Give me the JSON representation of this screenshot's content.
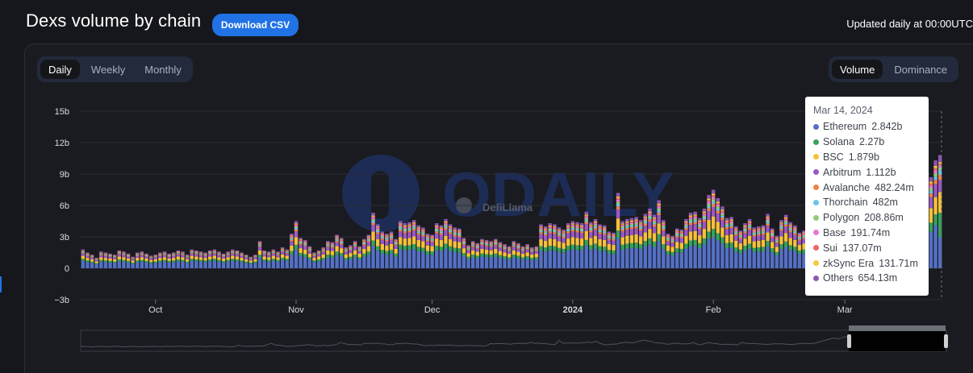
{
  "header": {
    "title": "Dexs volume by chain",
    "download_label": "Download CSV",
    "updated_text": "Updated daily at 00:00UTC"
  },
  "controls": {
    "interval_tabs": [
      "Daily",
      "Weekly",
      "Monthly"
    ],
    "interval_active": "Daily",
    "mode_tabs": [
      "Volume",
      "Dominance"
    ],
    "mode_active": "Volume"
  },
  "watermark": {
    "logo_text": "ODAILY",
    "sub_text": "DefiLlama"
  },
  "tooltip": {
    "date": "Mar 14, 2024",
    "items": [
      {
        "name": "Ethereum",
        "value": "2.842b",
        "color": "#5470c6"
      },
      {
        "name": "Solana",
        "value": "2.27b",
        "color": "#38a15c"
      },
      {
        "name": "BSC",
        "value": "1.879b",
        "color": "#f5c13b"
      },
      {
        "name": "Arbitrum",
        "value": "1.112b",
        "color": "#9c58c5"
      },
      {
        "name": "Avalanche",
        "value": "482.24m",
        "color": "#f0804a"
      },
      {
        "name": "Thorchain",
        "value": "482m",
        "color": "#6cc3e8"
      },
      {
        "name": "Polygon",
        "value": "208.86m",
        "color": "#91cc75"
      },
      {
        "name": "Base",
        "value": "191.74m",
        "color": "#e67ad0"
      },
      {
        "name": "Sui",
        "value": "137.07m",
        "color": "#ee6666"
      },
      {
        "name": "zkSync Era",
        "value": "131.71m",
        "color": "#f7c83f"
      },
      {
        "name": "Others",
        "value": "654.13m",
        "color": "#8e56b2"
      }
    ]
  },
  "chart_data": {
    "type": "bar",
    "stacked": true,
    "ylim": [
      -3,
      15
    ],
    "y_ticks": [
      "15b",
      "12b",
      "9b",
      "6b",
      "3b",
      "0",
      "−3b"
    ],
    "x_ticks": [
      "Oct",
      "Nov",
      "Dec",
      "2024",
      "Feb",
      "Mar"
    ],
    "grid": true,
    "date_range": [
      "2023-09-15",
      "2024-03-14"
    ],
    "stack_order": [
      "Ethereum",
      "Solana",
      "BSC",
      "Arbitrum",
      "Avalanche",
      "Thorchain",
      "Polygon",
      "Base",
      "Sui",
      "zkSync Era",
      "Others"
    ],
    "total_volume_b": [
      1.8,
      1.5,
      1.3,
      1.0,
      1.6,
      1.5,
      1.4,
      1.3,
      1.7,
      1.6,
      1.4,
      1.1,
      1.5,
      1.6,
      1.4,
      1.2,
      1.3,
      1.5,
      1.6,
      1.4,
      1.5,
      1.7,
      1.6,
      1.3,
      1.8,
      1.7,
      1.6,
      1.5,
      1.7,
      1.8,
      1.6,
      1.4,
      1.6,
      1.8,
      1.7,
      1.5,
      1.3,
      1.1,
      1.3,
      2.6,
      1.7,
      1.6,
      1.8,
      1.6,
      2.0,
      1.8,
      3.3,
      4.5,
      2.9,
      2.7,
      2.1,
      1.5,
      1.7,
      2.0,
      2.6,
      2.5,
      3.2,
      2.9,
      2.0,
      2.2,
      2.6,
      2.1,
      2.8,
      3.2,
      5.3,
      4.2,
      3.5,
      3.3,
      3.5,
      2.8,
      4.5,
      4.3,
      4.4,
      4.6,
      4.1,
      3.9,
      3.3,
      3.2,
      4.3,
      4.1,
      4.7,
      4.2,
      3.9,
      3.8,
      2.9,
      2.2,
      2.6,
      2.4,
      2.8,
      2.7,
      2.6,
      2.8,
      2.5,
      2.3,
      2.1,
      2.6,
      2.4,
      2.1,
      2.3,
      2.0,
      2.1,
      4.2,
      4.0,
      4.3,
      4.2,
      3.9,
      3.7,
      4.3,
      4.5,
      4.4,
      4.3,
      5.4,
      4.4,
      4.7,
      4.2,
      4.1,
      3.5,
      3.4,
      7.2,
      4.5,
      4.7,
      4.8,
      4.9,
      4.6,
      5.2,
      5.7,
      5.1,
      6.5,
      4.6,
      3.3,
      3.1,
      3.8,
      3.7,
      4.7,
      5.3,
      5.4,
      4.8,
      5.7,
      7.0,
      7.5,
      6.7,
      5.9,
      4.8,
      4.9,
      4.0,
      3.6,
      4.3,
      4.7,
      3.9,
      4.0,
      4.1,
      5.2,
      3.8,
      3.1,
      4.6,
      5.1,
      4.4,
      4.1,
      3.4,
      3.6,
      3.5,
      3.3,
      3.0,
      5.3,
      4.5,
      4.2,
      4.4,
      4.1,
      3.8,
      3.5,
      3.7,
      4.0,
      4.0,
      4.1,
      3.7,
      3.4,
      3.6,
      4.1,
      4.5,
      4.3,
      4.2,
      4.6,
      5.8,
      6.7,
      7.8,
      8.9,
      9.5,
      8.7,
      10.3,
      10.8
    ]
  }
}
